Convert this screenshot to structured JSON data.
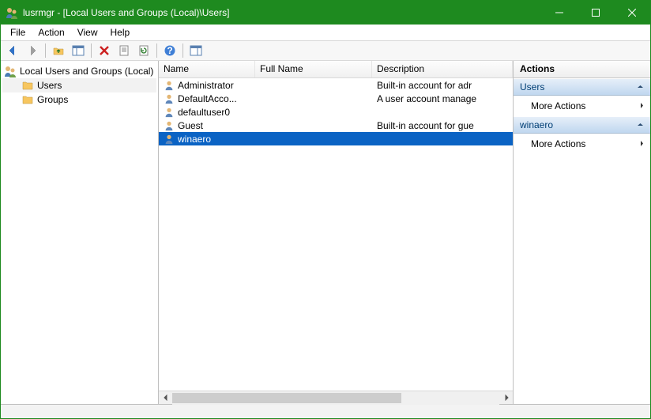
{
  "window_title": "lusrmgr - [Local Users and Groups (Local)\\Users]",
  "menubar": [
    "File",
    "Action",
    "View",
    "Help"
  ],
  "tree": {
    "root_label": "Local Users and Groups (Local)",
    "children": [
      {
        "label": "Users",
        "selected": true
      },
      {
        "label": "Groups",
        "selected": false
      }
    ]
  },
  "list": {
    "columns": {
      "name": "Name",
      "full_name": "Full Name",
      "description": "Description"
    },
    "rows": [
      {
        "name": "Administrator",
        "full_name": "",
        "description": "Built-in account for adr",
        "selected": false
      },
      {
        "name": "DefaultAcco...",
        "full_name": "",
        "description": "A user account manage",
        "selected": false
      },
      {
        "name": "defaultuser0",
        "full_name": "",
        "description": "",
        "selected": false
      },
      {
        "name": "Guest",
        "full_name": "",
        "description": "Built-in account for gue",
        "selected": false
      },
      {
        "name": "winaero",
        "full_name": "",
        "description": "",
        "selected": true
      }
    ]
  },
  "actions": {
    "title": "Actions",
    "sections": [
      {
        "head": "Users",
        "items": [
          "More Actions"
        ]
      },
      {
        "head": "winaero",
        "items": [
          "More Actions"
        ]
      }
    ]
  }
}
